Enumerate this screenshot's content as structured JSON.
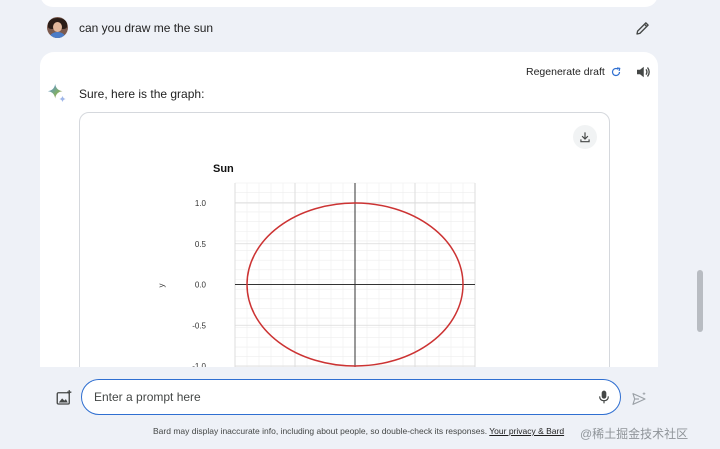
{
  "conversation": {
    "query": "can you draw me the sun",
    "regenerate_label": "Regenerate draft",
    "response_text": "Sure, here is the graph:"
  },
  "chart_data": {
    "type": "line",
    "title": "Sun",
    "xlabel": "",
    "ylabel": "y",
    "ylim": [
      -1.0,
      1.0
    ],
    "yticks": [
      "1.0",
      "0.5",
      "0.0",
      "-0.5",
      "-1.0"
    ],
    "xlim": [
      -1.0,
      1.0
    ],
    "grid": true,
    "series": [
      {
        "color": "#cc3333",
        "shape": "circle",
        "center": [
          0,
          0
        ],
        "radius": 1.0
      }
    ]
  },
  "input": {
    "placeholder": "Enter a prompt here",
    "value": ""
  },
  "footer": {
    "disclaimer": "Bard may display inaccurate info, including about people, so double-check its responses.",
    "privacy_link": "Your privacy & Bard"
  },
  "watermark": "@稀土掘金技术社区",
  "colors": {
    "accent": "#2f6fd1",
    "circle": "#cc3333",
    "background": "#eef1f7"
  },
  "icons": {
    "edit": "pencil-icon",
    "regenerate": "refresh-icon",
    "speaker": "speaker-icon",
    "bard": "sparkle-icon",
    "download": "download-icon",
    "image_upload": "image-upload-icon",
    "mic": "mic-icon",
    "send": "send-icon"
  }
}
